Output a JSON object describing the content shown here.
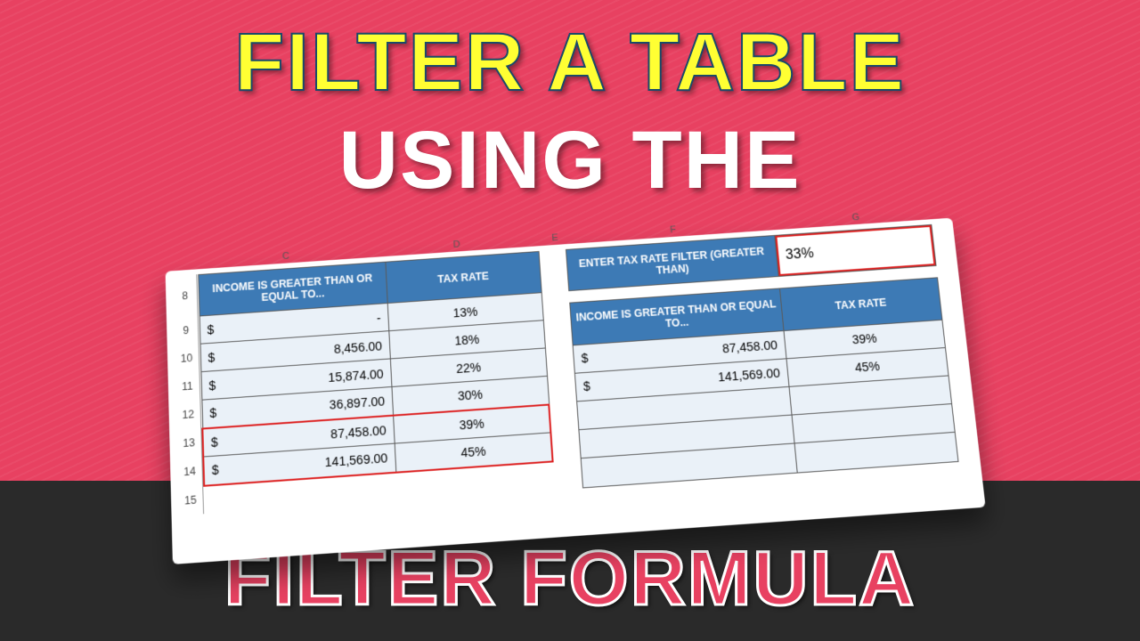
{
  "titles": {
    "line1": "FILTER A TABLE",
    "line2": "USING THE",
    "line3": "FILTER FORMULA"
  },
  "columns": [
    "C",
    "D",
    "E",
    "F",
    "G"
  ],
  "row_numbers": [
    "8",
    "9",
    "10",
    "11",
    "12",
    "13",
    "14",
    "15"
  ],
  "left": {
    "h1": "INCOME IS GREATER THAN OR EQUAL TO...",
    "h2": "TAX RATE",
    "rows": [
      {
        "cur": "$",
        "amt": "-",
        "rate": "13%"
      },
      {
        "cur": "$",
        "amt": "8,456.00",
        "rate": "18%"
      },
      {
        "cur": "$",
        "amt": "15,874.00",
        "rate": "22%"
      },
      {
        "cur": "$",
        "amt": "36,897.00",
        "rate": "30%"
      },
      {
        "cur": "$",
        "amt": "87,458.00",
        "rate": "39%"
      },
      {
        "cur": "$",
        "amt": "141,569.00",
        "rate": "45%"
      }
    ]
  },
  "right": {
    "filter_label": "ENTER TAX RATE FILTER (GREATER THAN)",
    "filter_value": "33%",
    "h1": "INCOME IS GREATER THAN OR EQUAL TO...",
    "h2": "TAX RATE",
    "rows": [
      {
        "cur": "$",
        "amt": "87,458.00",
        "rate": "39%"
      },
      {
        "cur": "$",
        "amt": "141,569.00",
        "rate": "45%"
      }
    ]
  }
}
